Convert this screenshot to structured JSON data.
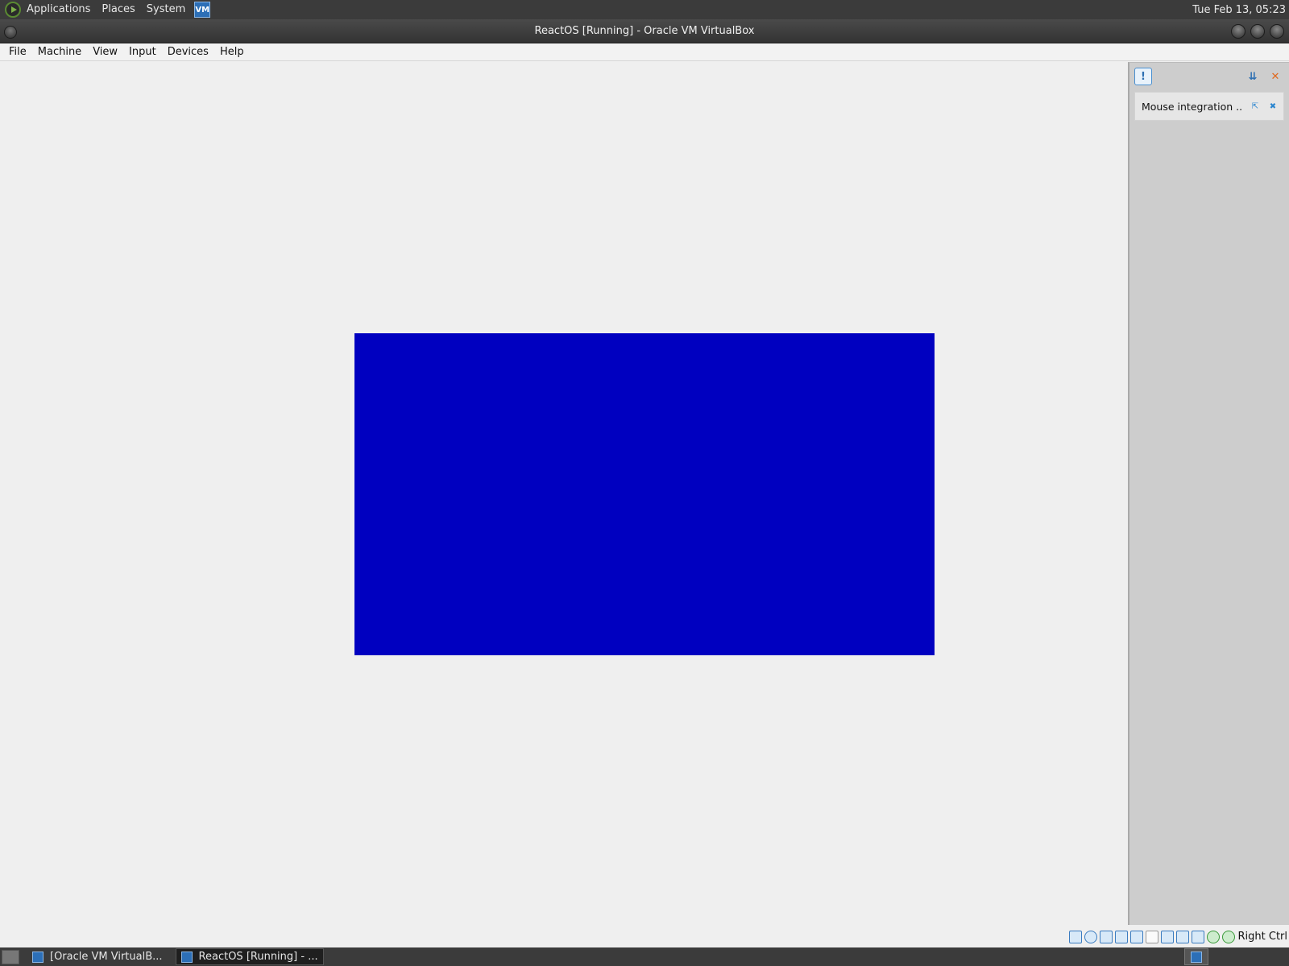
{
  "top_panel": {
    "menus": [
      "Applications",
      "Places",
      "System"
    ],
    "clock": "Tue Feb 13, 05:23",
    "vbox_launcher_text": "VM"
  },
  "window": {
    "title": "ReactOS [Running] - Oracle VM VirtualBox"
  },
  "menubar": {
    "items": [
      "File",
      "Machine",
      "View",
      "Input",
      "Devices",
      "Help"
    ]
  },
  "vm_display": {
    "screen_color": "#0000c0"
  },
  "notification_center": {
    "toggle_icon_glyph": "!",
    "hide_all_icon_glyph": "⇊",
    "close_all_icon_glyph": "✕",
    "items": [
      {
        "text": "Mouse integration ...",
        "hide_glyph": "⇱",
        "close_glyph": "✖"
      }
    ]
  },
  "statusbar": {
    "indicators": [
      "hard-disk",
      "optical-drive",
      "audio",
      "network",
      "usb",
      "shared-folders",
      "display",
      "recording",
      "virtualization",
      "guest-additions",
      "mouse-integration"
    ],
    "host_key": "Right Ctrl"
  },
  "taskbar": {
    "tasks": [
      {
        "label": "[Oracle VM VirtualB...",
        "active": false
      },
      {
        "label": "ReactOS [Running] - ...",
        "active": true
      }
    ]
  }
}
